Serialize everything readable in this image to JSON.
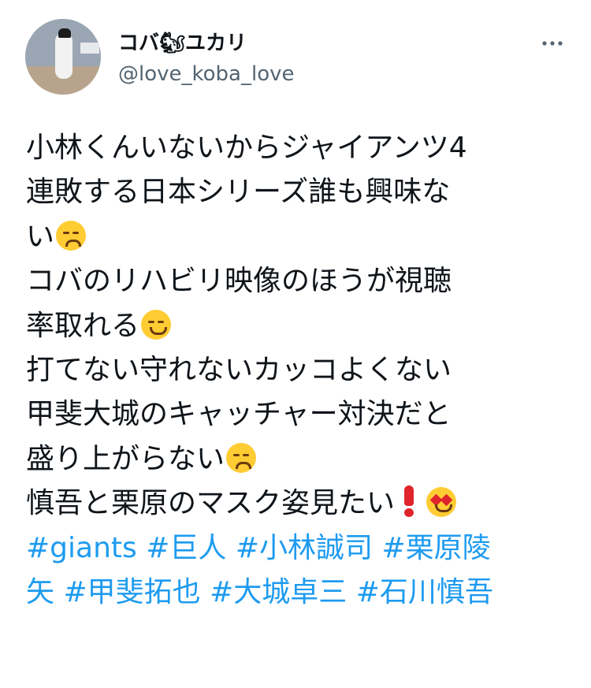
{
  "user": {
    "display_name": "コバ🐿ユカリ",
    "handle": "@love_koba_love"
  },
  "icons": {
    "more": "more-horizontal-icon",
    "avatar": "avatar-photo"
  },
  "tweet": {
    "lines": [
      "小林くんいないからジャイアンツ4",
      "連敗する日本シリーズ誰も興味な",
      "い",
      "コバのリハビリ映像のほうが視聴",
      "率取れる",
      "打てない守れないカッコよくない",
      "甲斐大城のキャッチャー対決だと",
      "盛り上がらない",
      "慎吾と栗原のマスク姿見たい"
    ],
    "hashtags_line1": [
      "#giants",
      "#巨人",
      "#小林誠司",
      "#栗原陵"
    ],
    "hashtags_line2": [
      "矢",
      "#甲斐拓也",
      "#大城卓三",
      "#石川慎吾"
    ]
  },
  "colors": {
    "text": "#0f1419",
    "secondary": "#536471",
    "hashtag": "#1d9bf0"
  }
}
